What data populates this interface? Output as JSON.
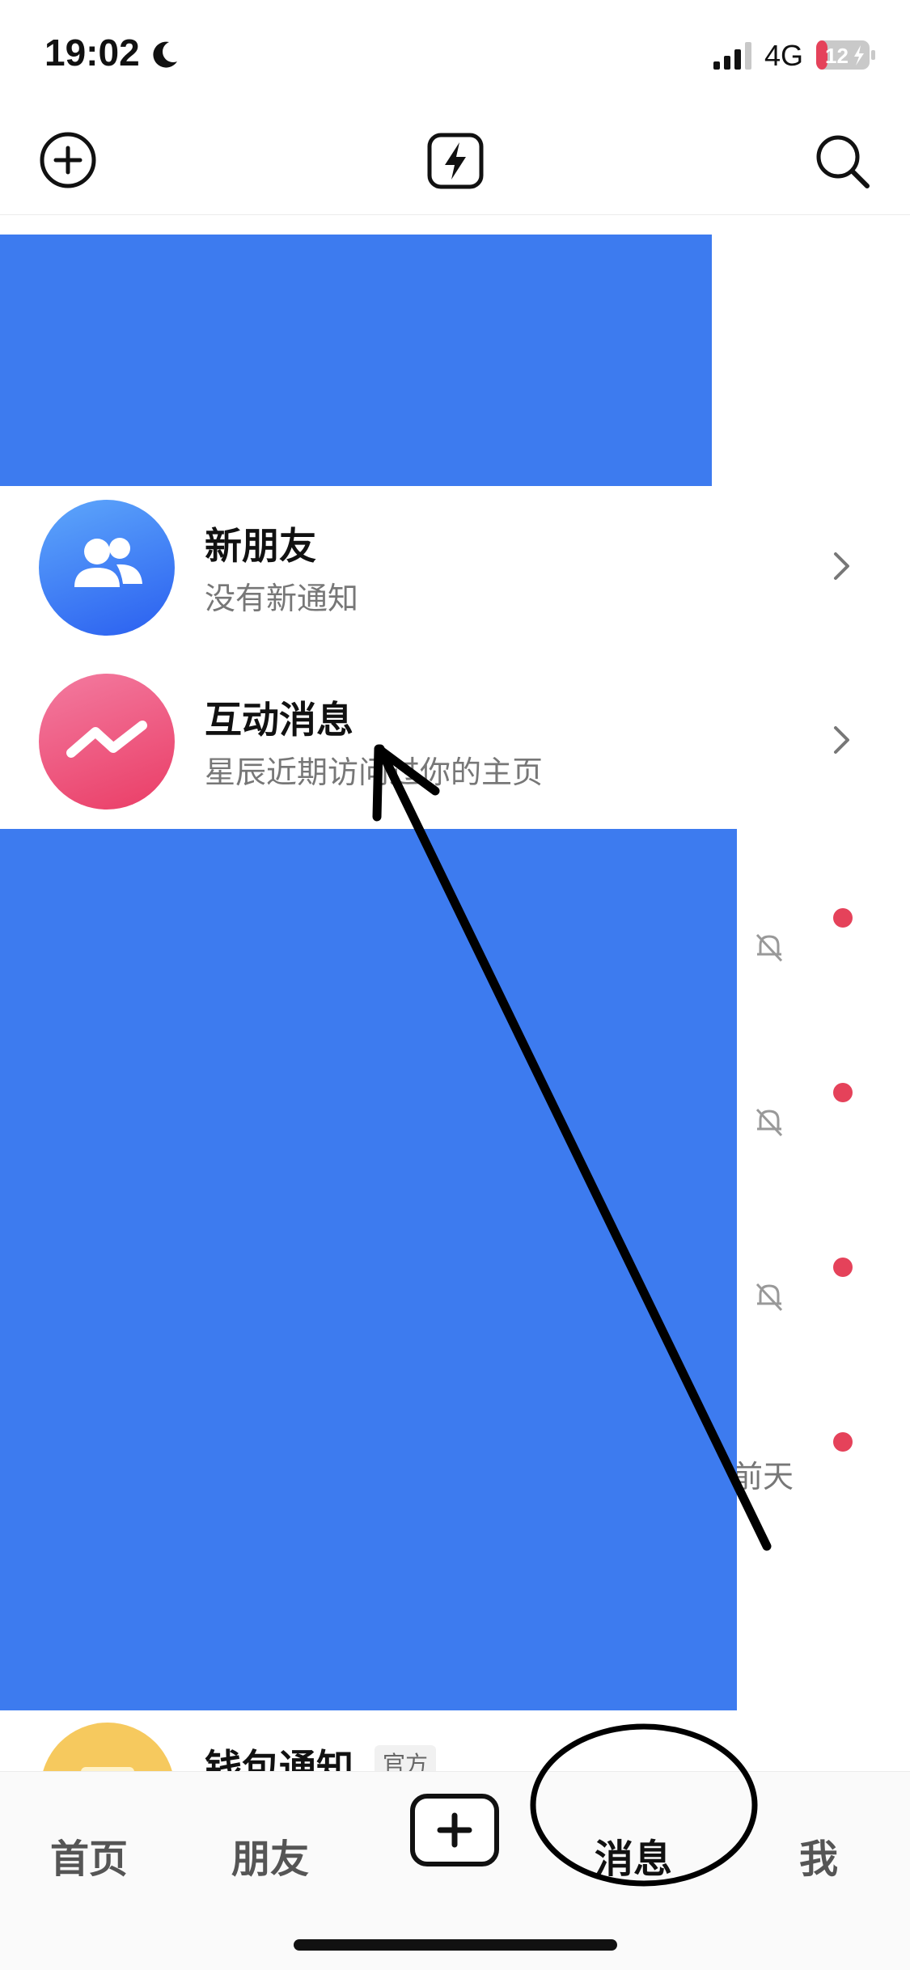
{
  "status_bar": {
    "time": "19:02",
    "network": "4G",
    "battery": "12"
  },
  "top_nav": {
    "icons": [
      "add-icon",
      "flash-icon",
      "search-icon"
    ]
  },
  "list": [
    {
      "title": "新朋友",
      "subtitle": "没有新通知",
      "icon": "friends-icon"
    },
    {
      "title": "互动消息",
      "subtitle": "星辰近期访问过你的主页",
      "icon": "interaction-icon"
    }
  ],
  "partial_time": "前天",
  "wallet": {
    "title": "钱包通知",
    "badge": "官方"
  },
  "tabs": {
    "home": "首页",
    "friends": "朋友",
    "messages": "消息",
    "me": "我"
  },
  "colors": {
    "redaction": "#3d7bef",
    "unread": "#e5425a",
    "avatar_blue": "#2a5ff0",
    "avatar_pink": "#ea3d66",
    "avatar_yellow": "#f6c95e"
  }
}
